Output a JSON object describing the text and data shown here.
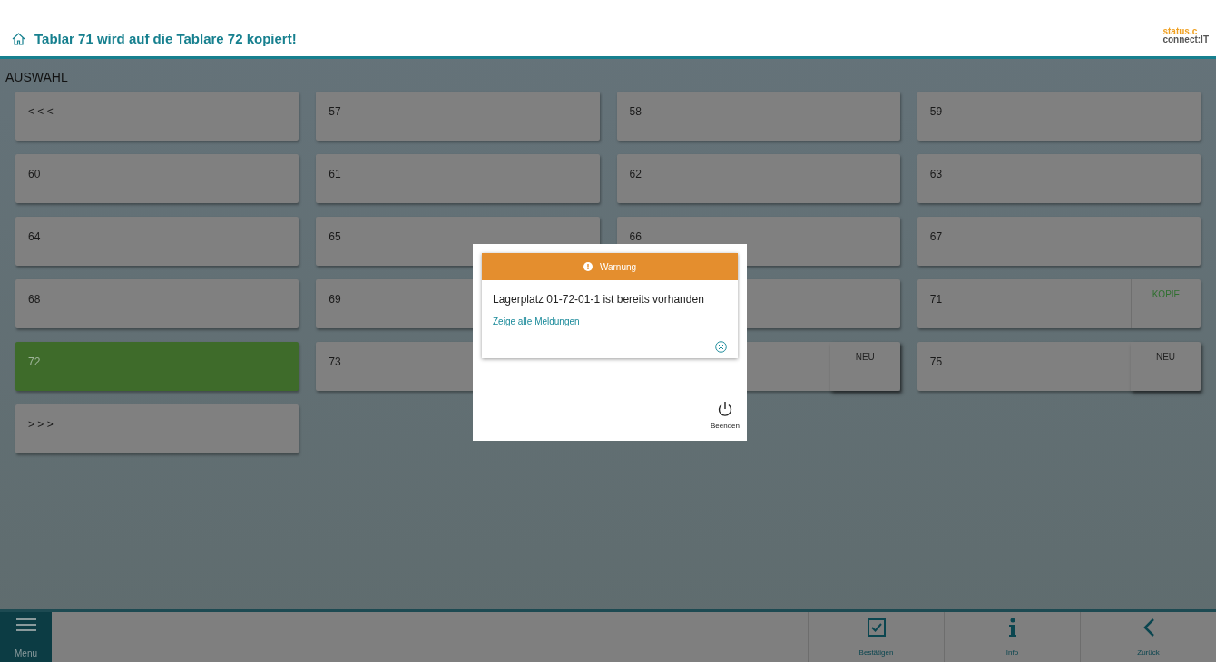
{
  "header": {
    "title": "Tablar 71 wird auf die Tablare 72 kopiert!",
    "logo": {
      "line_1": "status.c",
      "line_2": "connect:IT"
    }
  },
  "section_title": "AUSWAHL",
  "tiles": [
    {
      "label": "< < <",
      "selected": false
    },
    {
      "label": "57",
      "selected": false
    },
    {
      "label": "58",
      "selected": false
    },
    {
      "label": "59",
      "selected": false
    },
    {
      "label": "60",
      "selected": false
    },
    {
      "label": "61",
      "selected": false
    },
    {
      "label": "62",
      "selected": false
    },
    {
      "label": "63",
      "selected": false
    },
    {
      "label": "64",
      "selected": false
    },
    {
      "label": "65",
      "selected": false
    },
    {
      "label": "66",
      "selected": false
    },
    {
      "label": "67",
      "selected": false
    },
    {
      "label": "68",
      "selected": false
    },
    {
      "label": "69",
      "selected": false
    },
    {
      "selected": false
    },
    {
      "label": "71",
      "selected": false,
      "badge": {
        "kind": "copy",
        "text": "KOPIE"
      }
    },
    {
      "label": "72",
      "selected": true
    },
    {
      "label": "73",
      "selected": false
    },
    {
      "selected": false,
      "badge": {
        "kind": "new",
        "text": "NEU"
      }
    },
    {
      "label": "75",
      "selected": false,
      "badge": {
        "kind": "new",
        "text": "NEU"
      }
    },
    {
      "label": "> > >",
      "selected": false
    }
  ],
  "dialog": {
    "alert": {
      "title": "Warnung",
      "message": "Lagerplatz 01-72-01-1 ist bereits vorhanden",
      "link": "Zeige alle Meldungen"
    },
    "action": {
      "label": "Beenden"
    }
  },
  "bottom_bar": {
    "menu": {
      "label": "Menu"
    },
    "actions": [
      {
        "kind": "confirm",
        "label": "Bestätigen"
      },
      {
        "kind": "info",
        "label": "Info"
      },
      {
        "kind": "back",
        "label": "Zurück"
      }
    ]
  }
}
